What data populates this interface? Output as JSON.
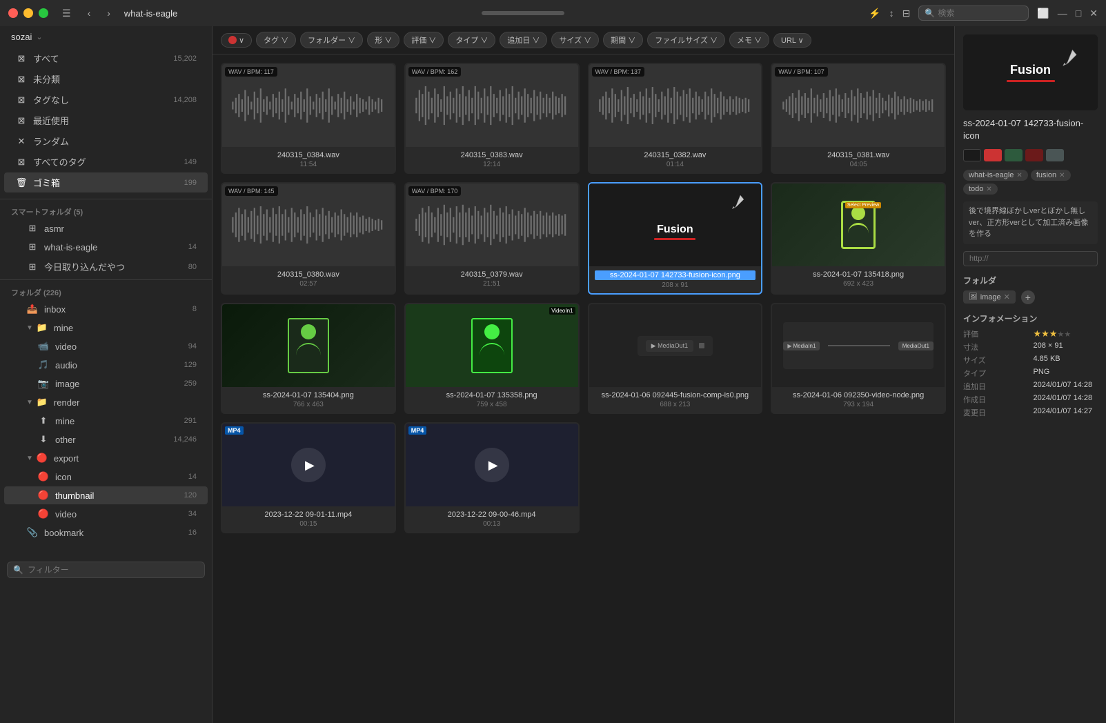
{
  "titlebar": {
    "breadcrumb": "what-is-eagle",
    "back_btn": "‹",
    "forward_btn": "›",
    "menu_btn": "☰",
    "close_btn": "✕",
    "min_btn": "−",
    "max_btn": "□",
    "search_placeholder": "検索"
  },
  "filters": [
    {
      "label": "タグ ∨",
      "id": "tag"
    },
    {
      "label": "フォルダー ∨",
      "id": "folder"
    },
    {
      "label": "形 ∨",
      "id": "shape"
    },
    {
      "label": "評価 ∨",
      "id": "rating"
    },
    {
      "label": "タイプ ∨",
      "id": "type"
    },
    {
      "label": "追加日 ∨",
      "id": "added"
    },
    {
      "label": "サイズ ∨",
      "id": "size"
    },
    {
      "label": "期間 ∨",
      "id": "duration"
    },
    {
      "label": "ファイルサイズ ∨",
      "id": "filesize"
    },
    {
      "label": "メモ ∨",
      "id": "memo"
    },
    {
      "label": "URL ∨",
      "id": "url"
    }
  ],
  "sidebar": {
    "workspace": "sozai",
    "items": [
      {
        "label": "すべて",
        "icon": "⊠",
        "count": "15,202",
        "id": "all"
      },
      {
        "label": "未分類",
        "icon": "⊠",
        "count": "",
        "id": "uncategorized"
      },
      {
        "label": "タグなし",
        "icon": "⊠",
        "count": "14,208",
        "id": "no-tag"
      },
      {
        "label": "最近使用",
        "icon": "⊠",
        "count": "",
        "id": "recent"
      },
      {
        "label": "ランダム",
        "icon": "✕",
        "count": "",
        "id": "random"
      },
      {
        "label": "すべてのタグ",
        "icon": "⊠",
        "count": "149",
        "id": "all-tags"
      },
      {
        "label": "ゴミ箱",
        "icon": "🗑",
        "count": "199",
        "id": "trash",
        "active": true
      }
    ],
    "smart_folders_title": "スマートフォルダ (5)",
    "smart_folders": [
      {
        "label": "asmr",
        "count": ""
      },
      {
        "label": "what-is-eagle",
        "count": "14"
      },
      {
        "label": "今日取り込んだやつ",
        "count": "80"
      }
    ],
    "folders_title": "フォルダ (226)",
    "folders": [
      {
        "label": "inbox",
        "count": "8",
        "indent": 1
      },
      {
        "label": "mine",
        "count": "",
        "indent": 1,
        "expanded": true
      },
      {
        "label": "video",
        "count": "94",
        "indent": 2
      },
      {
        "label": "audio",
        "count": "129",
        "indent": 2
      },
      {
        "label": "image",
        "count": "259",
        "indent": 2
      },
      {
        "label": "render",
        "count": "",
        "indent": 1,
        "expanded": true
      },
      {
        "label": "mine",
        "count": "291",
        "indent": 2,
        "upload": true
      },
      {
        "label": "other",
        "count": "14,246",
        "indent": 2
      },
      {
        "label": "export",
        "count": "",
        "indent": 1,
        "expanded": true
      },
      {
        "label": "icon",
        "count": "14",
        "indent": 2
      },
      {
        "label": "thumbnail",
        "count": "120",
        "indent": 2,
        "active": true
      },
      {
        "label": "video",
        "count": "34",
        "indent": 2
      },
      {
        "label": "bookmark",
        "count": "16",
        "indent": 1
      }
    ],
    "filter_placeholder": "フィルター"
  },
  "grid_items": [
    {
      "id": "item1",
      "type": "audio",
      "bpm": "WAV / BPM: 117",
      "filename": "240315_0384.wav",
      "meta": "11:54",
      "selected": false
    },
    {
      "id": "item2",
      "type": "audio",
      "bpm": "WAV / BPM: 162",
      "filename": "240315_0383.wav",
      "meta": "12:14",
      "selected": false
    },
    {
      "id": "item3",
      "type": "audio",
      "bpm": "WAV / BPM: 137",
      "filename": "240315_0382.wav",
      "meta": "01:14",
      "selected": false
    },
    {
      "id": "item4",
      "type": "audio",
      "bpm": "WAV / BPM: 107",
      "filename": "240315_0381.wav",
      "meta": "04:05",
      "selected": false
    },
    {
      "id": "item5",
      "type": "audio",
      "bpm": "WAV / BPM: 145",
      "filename": "240315_0380.wav",
      "meta": "02:57",
      "selected": false
    },
    {
      "id": "item6",
      "type": "audio",
      "bpm": "WAV / BPM: 170",
      "filename": "240315_0379.wav",
      "meta": "21:51",
      "selected": false
    },
    {
      "id": "item7",
      "type": "image",
      "bpm": "",
      "filename": "ss-2024-01-07 142733-fusion-icon.png",
      "meta": "208 x 91",
      "selected": true,
      "is_fusion": true
    },
    {
      "id": "item8",
      "type": "image",
      "bpm": "",
      "filename": "ss-2024-01-07 135418.png",
      "meta": "692 x 423",
      "selected": false,
      "is_person": true
    },
    {
      "id": "item9",
      "type": "image",
      "bpm": "",
      "filename": "ss-2024-01-07 135404.png",
      "meta": "766 x 463",
      "selected": false,
      "is_person_dark": true
    },
    {
      "id": "item10",
      "type": "image",
      "bpm": "",
      "filename": "ss-2024-01-07 135358.png",
      "meta": "759 x 458",
      "selected": false,
      "is_person_green": true
    },
    {
      "id": "item11",
      "type": "image",
      "bpm": "",
      "filename": "ss-2024-01-06 092445-fusion-comp-is0.png",
      "meta": "688 x 213",
      "selected": false,
      "is_media_out": true
    },
    {
      "id": "item12",
      "type": "image",
      "bpm": "",
      "filename": "ss-2024-01-06 092350-video-node.png",
      "meta": "793 x 194",
      "selected": false,
      "is_node": true
    },
    {
      "id": "item13",
      "type": "video",
      "bpm": "",
      "filename": "2023-12-22 09-01-11.mp4",
      "meta": "00:15",
      "selected": false,
      "is_mp4": true
    },
    {
      "id": "item14",
      "type": "video",
      "bpm": "",
      "filename": "2023-12-22 09-00-46.mp4",
      "meta": "00:13",
      "selected": false,
      "is_mp4": true
    }
  ],
  "right_panel": {
    "title": "ss-2024-01-07 142733-fusion-icon",
    "tags": [
      "what-is-eagle",
      "fusion",
      "todo"
    ],
    "note": "後で境界線ぼかしverとぼかし無しver、正方形verとして加工済み画像を作る",
    "url_placeholder": "http://",
    "folder_section": "フォルダ",
    "folder_tags": [
      "image"
    ],
    "info_section": "インフォメーション",
    "info": {
      "rating_label": "評価",
      "rating_stars": 3,
      "size_label": "寸法",
      "size_value": "208 × 91",
      "filesize_label": "サイズ",
      "filesize_value": "4.85 KB",
      "type_label": "タイプ",
      "type_value": "PNG",
      "added_label": "追加日",
      "added_value": "2024/01/07 14:28",
      "created_label": "作成日",
      "created_value": "2024/01/07 14:28",
      "modified_label": "変更日",
      "modified_value": "2024/01/07 14:27"
    },
    "swatches": [
      "#1a1a1a",
      "#cc3333",
      "#2d5a3d",
      "#6b1a1a",
      "#4a5555"
    ]
  }
}
